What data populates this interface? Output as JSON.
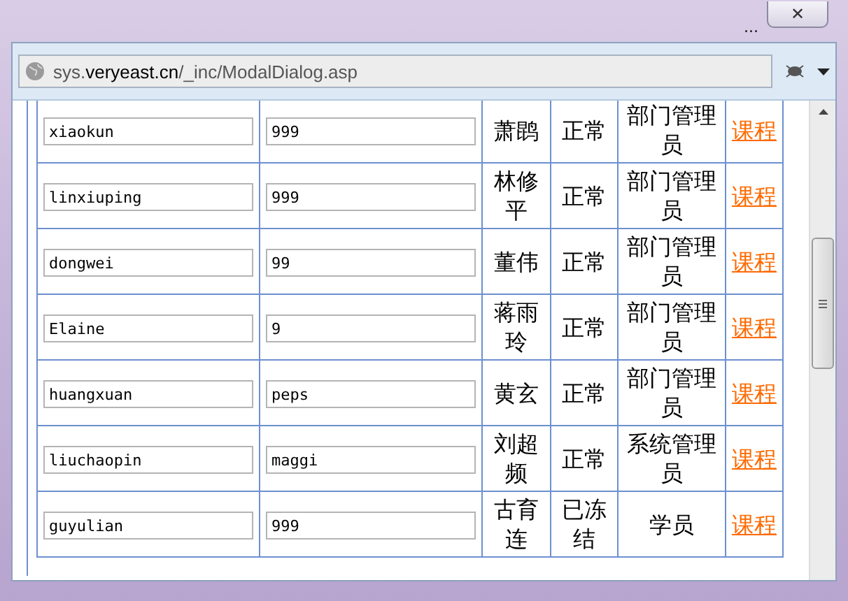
{
  "window": {
    "more": "...",
    "close": "✕"
  },
  "address_bar": {
    "url_prefix": "sys.",
    "url_domain": "veryeast.cn",
    "url_path": "/_inc/ModalDialog.asp"
  },
  "rows": [
    {
      "username": "xiaokun",
      "password": "999",
      "name": "萧鹍",
      "status": "正常",
      "role": "部门管理员",
      "link": "课程"
    },
    {
      "username": "linxiuping",
      "password": "999",
      "name": "林修平",
      "status": "正常",
      "role": "部门管理员",
      "link": "课程"
    },
    {
      "username": "dongwei",
      "password": "99",
      "name": "董伟",
      "status": "正常",
      "role": "部门管理员",
      "link": "课程"
    },
    {
      "username": "Elaine",
      "password": "9",
      "name": "蒋雨玲",
      "status": "正常",
      "role": "部门管理员",
      "link": "课程"
    },
    {
      "username": "huangxuan",
      "password": "peps",
      "name": "黄玄",
      "status": "正常",
      "role": "部门管理员",
      "link": "课程"
    },
    {
      "username": "liuchaopin",
      "password": "maggi",
      "name": "刘超频",
      "status": "正常",
      "role": "系统管理员",
      "link": "课程"
    },
    {
      "username": "guyulian",
      "password": "999",
      "name": "古育连",
      "status": "已冻结",
      "role": "学员",
      "link": "课程"
    }
  ]
}
